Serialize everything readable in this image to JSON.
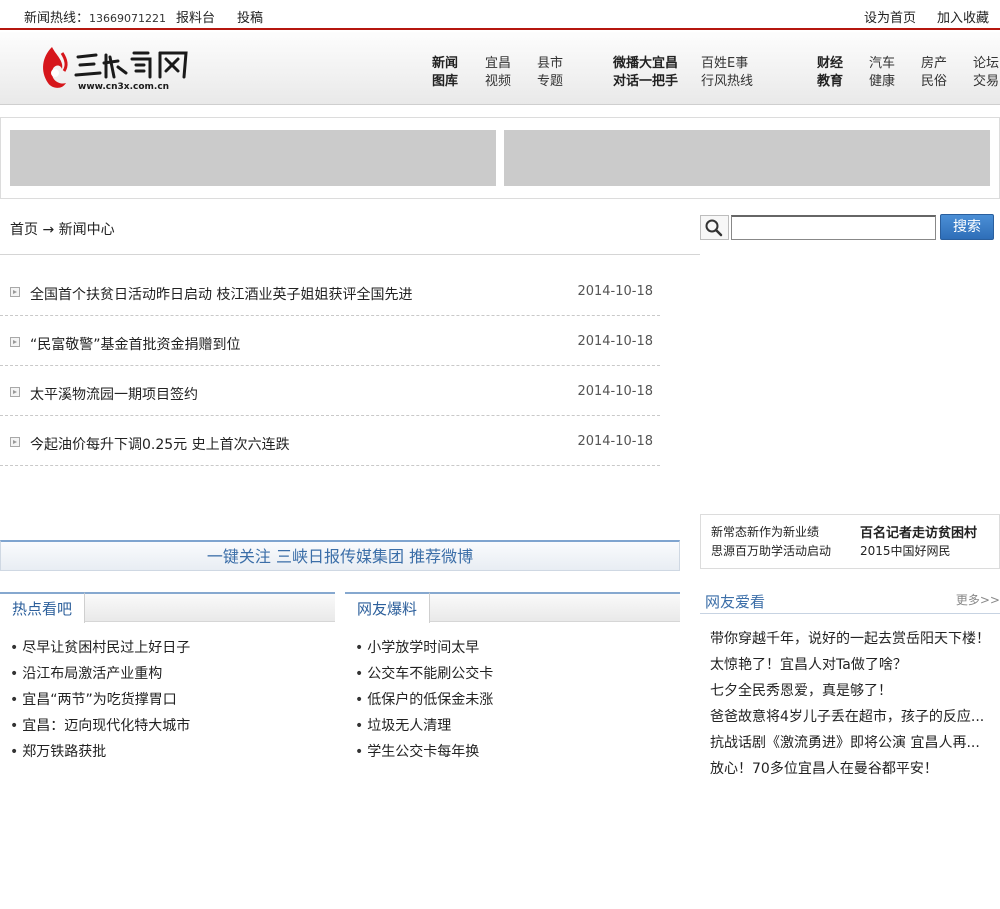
{
  "topbar": {
    "hotline_label": "新闻热线：",
    "hotline_number": "13669071221",
    "report_link": "报料台",
    "submit_link": "投稿",
    "set_home": "设为首页",
    "add_favorite": "加入收藏"
  },
  "header": {
    "logo_text": "三峡宜昌网",
    "logo_url_text": "www.cn3x.com.cn",
    "nav": {
      "g1": [
        "新闻",
        "宜昌",
        "县市",
        "图库",
        "视频",
        "专题"
      ],
      "g2": [
        "微播大宜昌",
        "百姓E事",
        "对话一把手",
        "行风热线"
      ],
      "g3": [
        "财经",
        "汽车",
        "房产",
        "论坛",
        "教育",
        "健康",
        "民俗",
        "交易"
      ]
    }
  },
  "breadcrumb": {
    "home": "首页",
    "arrow": "→",
    "current": "新闻中心"
  },
  "search": {
    "placeholder": "",
    "button_label": "搜索"
  },
  "news": [
    {
      "title": "全国首个扶贫日活动昨日启动 枝江酒业英子姐姐获评全国先进",
      "date": "2014-10-18"
    },
    {
      "title": "“民富敬警”基金首批资金捐赠到位",
      "date": "2014-10-18"
    },
    {
      "title": "太平溪物流园一期项目签约",
      "date": "2014-10-18"
    },
    {
      "title": "今起油价每升下调0.25元 史上首次六连跌",
      "date": "2014-10-18"
    }
  ],
  "side_links": {
    "l1": "新常态新作为新业绩",
    "r1": "百名记者走访贫困村",
    "l2": "思源百万助学活动启动",
    "r2": "2015中国好网民"
  },
  "follow_bar": "一键关注 三峡日报传媒集团 推荐微博",
  "hot": {
    "title": "热点看吧",
    "items": [
      "尽早让贫困村民过上好日子",
      "沿江布局激活产业重构",
      "宜昌“两节”为吃货撑胃口",
      "宜昌：迈向现代化特大城市",
      "郑万铁路获批"
    ]
  },
  "netizen": {
    "title": "网友爆料",
    "items": [
      "小学放学时间太早",
      "公交车不能刷公交卡",
      "低保户的低保金未涨",
      "垃圾无人清理",
      "学生公交卡每年换"
    ]
  },
  "love": {
    "title": "网友爱看",
    "more": "更多>>",
    "items": [
      "带你穿越千年，说好的一起去赏岳阳天下楼！",
      "太惊艳了！宜昌人对Ta做了啥？",
      "七夕全民秀恩爱，真是够了！",
      "爸爸故意将4岁儿子丢在超市，孩子的反应...",
      "抗战话剧《激流勇进》即将公演 宜昌人再...",
      "放心！70多位宜昌人在曼谷都平安！"
    ]
  }
}
